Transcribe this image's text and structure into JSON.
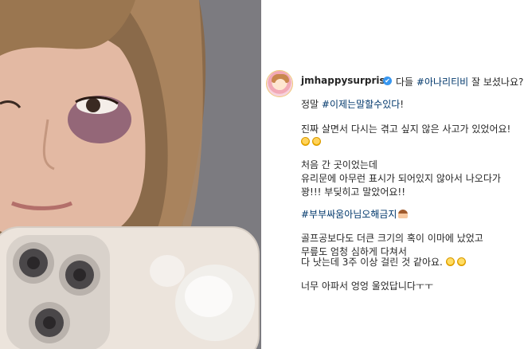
{
  "post": {
    "username": "jmhappysurprise",
    "verified_mark": "✔",
    "caption_first_prefix": "다들 ",
    "caption_first_tag": "#아나리티비",
    "caption_first_suffix": " 잘 보셨나요?",
    "line2_prefix": "정말 ",
    "line2_tag": "#이제는말할수있다",
    "line2_suffix": "!",
    "line3": "진짜 살면서 다시는 겪고 싶지 않은 사고가 있었어요!",
    "line5": "처음 간 곳이었는데",
    "line6": "유리문에 아무런 표시가 되어있지 않아서 나오다가",
    "line7": "꽝!!! 부딪히고 말았어요!!",
    "line8_tag": "#부부싸움아님오해금지",
    "line9": "골프공보다도 더큰 크기의 혹이 이마에 났었고",
    "line10": "무릎도 엄청 심하게 다쳐서",
    "line11": "다 낫는데 3주 이상 걸린 것 같아요.",
    "line12": "너무 아파서 엉엉 울었답니다ㅜㅜ"
  },
  "photo": {
    "description_icons": [
      "phone-case",
      "camera-lenses",
      "bruised-eye"
    ]
  },
  "colors": {
    "hashtag": "#00376b",
    "verified": "#3897f0",
    "text": "#262626"
  }
}
